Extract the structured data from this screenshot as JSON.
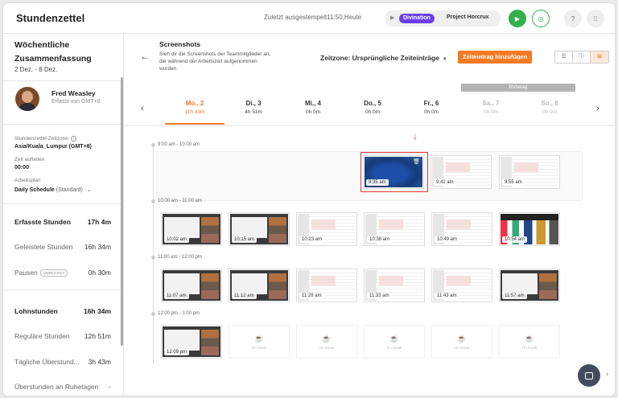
{
  "header": {
    "app_title": "Stundenzettel",
    "last_stamped": "Zuletzt ausgestempelt11:50,Heute",
    "timer": {
      "play_icon": "play-icon",
      "project": "Divination",
      "task": "Project Horcrux"
    },
    "icons": {
      "start": "play-icon",
      "user": "user-icon",
      "help": "help-icon",
      "apps": "grid-icon"
    },
    "accent_green": "#33b04a",
    "accent_purple": "#6a3de8"
  },
  "sidebar": {
    "summary_title": "Wöchentliche Zusammenfassung",
    "summary_range": "2 Dez. - 8 Dez.",
    "user_name": "Fred Weasley",
    "user_tz": "Erfasst von GMT+8",
    "tz_label": "Stundenzettel-Zeitzone",
    "tz_value": "Asia/Kuala_Lumpur (GMT+8)",
    "split_label": "Zeit aufteilen",
    "split_value": "00:00",
    "plan_label": "Arbeitsplan",
    "plan_value": "Daily Schedule",
    "plan_note": "(Standard)",
    "stats": {
      "tracked_label": "Erfasste Stunden",
      "tracked_value": "17h 4m",
      "worked_label": "Geleistete Stunden",
      "worked_value": "16h 34m",
      "breaks_label": "Pausen",
      "breaks_badge": "UNBEZAHLT",
      "breaks_value": "0h 30m",
      "pay_label": "Lohnstunden",
      "pay_value": "16h 34m",
      "regular_label": "Reguläre Stunden",
      "regular_value": "12h 51m",
      "daily_ot_label": "Tägliche Überstund...",
      "daily_ot_value": "3h 43m",
      "rest_ot_label": "Überstunden an Ruhetagen",
      "rest_ot_value": "-"
    }
  },
  "main": {
    "back_icon": "arrow-left-icon",
    "title": "Screenshots",
    "description": "Sieh dir die Screenshots der Teammitglieder an, die während der Arbeitszeit aufgenommen wurden",
    "timezone_select": "Zeitzone: Ursprüngliche Zeiteinträge",
    "add_entry": "Zeiteintrag hinzufügen",
    "view_icons": [
      "list-icon",
      "info-icon",
      "gallery-icon"
    ],
    "rest_day_label": "Ruhetag",
    "accent_orange": "#f57a23",
    "days": [
      {
        "name": "Mo., 2",
        "hours": "11h 43m"
      },
      {
        "name": "Di., 3",
        "hours": "4h 51m"
      },
      {
        "name": "Mi., 4",
        "hours": "0h 0m"
      },
      {
        "name": "Do., 5",
        "hours": "0h 0m"
      },
      {
        "name": "Fr., 6",
        "hours": "0h 0m"
      },
      {
        "name": "Sa., 7",
        "hours": "0h 0m"
      },
      {
        "name": "So., 8",
        "hours": "0h 0m"
      }
    ],
    "hour_groups": [
      {
        "label": "9:00 am - 10:00 am",
        "shots": [
          "9:35 am",
          "9:42 am",
          "9:55 am"
        ]
      },
      {
        "label": "10:00 am - 11:00 am",
        "shots": [
          "10:02 am",
          "10:15 am",
          "10:23 am",
          "10:38 am",
          "10:49 am",
          "10:54 am"
        ]
      },
      {
        "label": "11:00 am - 12:00 pm",
        "shots": [
          "11:07 am",
          "11:12 am",
          "11:28 am",
          "11:33 am",
          "11:43 am",
          "11:57 am"
        ]
      },
      {
        "label": "12:00 pm - 1:00 pm",
        "shots": [
          "12:09 pm"
        ],
        "break_label": "On break"
      }
    ]
  }
}
